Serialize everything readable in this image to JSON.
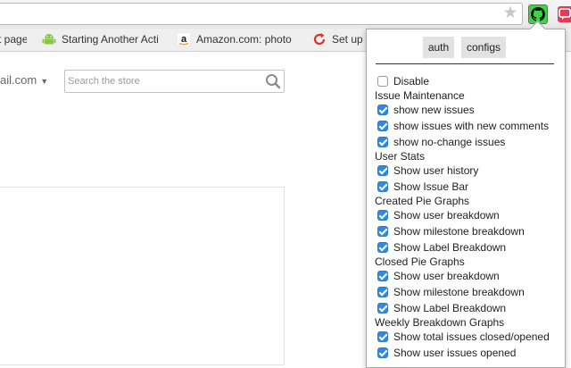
{
  "browser": {
    "bookmarks": [
      {
        "label": "t page",
        "icon": "page-icon"
      },
      {
        "label": "Starting Another Acti",
        "icon": "android-icon"
      },
      {
        "label": "Amazon.com: photo",
        "icon": "amazon-icon"
      },
      {
        "label": "Set up",
        "icon": "sync-icon"
      }
    ],
    "colors": {
      "extension_active": "#3ed63e",
      "extension_second": "#e43a57",
      "checkbox": "#2f8ae6"
    }
  },
  "page": {
    "account_email": "ail.com",
    "search": {
      "placeholder": "Search the store"
    }
  },
  "popup": {
    "tabs": [
      {
        "label": "auth"
      },
      {
        "label": "configs"
      }
    ],
    "disable": {
      "label": "Disable",
      "checked": false
    },
    "sections": [
      {
        "header": "Issue Maintenance",
        "items": [
          {
            "label": "show new issues",
            "checked": true
          },
          {
            "label": "show issues with new comments",
            "checked": true
          },
          {
            "label": "show no-change issues",
            "checked": true
          }
        ]
      },
      {
        "header": "User Stats",
        "items": [
          {
            "label": "Show user history",
            "checked": true
          },
          {
            "label": "Show Issue Bar",
            "checked": true
          }
        ]
      },
      {
        "header": "Created Pie Graphs",
        "items": [
          {
            "label": "Show user breakdown",
            "checked": true
          },
          {
            "label": "Show milestone breakdown",
            "checked": true
          },
          {
            "label": "Show Label Breakdown",
            "checked": true
          }
        ]
      },
      {
        "header": "Closed Pie Graphs",
        "items": [
          {
            "label": "Show user breakdown",
            "checked": true
          },
          {
            "label": "Show milestone breakdown",
            "checked": true
          },
          {
            "label": "Show Label Breakdown",
            "checked": true
          }
        ]
      },
      {
        "header": "Weekly Breakdown Graphs",
        "items": [
          {
            "label": "Show total issues closed/opened",
            "checked": true
          },
          {
            "label": "Show user issues opened",
            "checked": true
          }
        ]
      }
    ]
  }
}
